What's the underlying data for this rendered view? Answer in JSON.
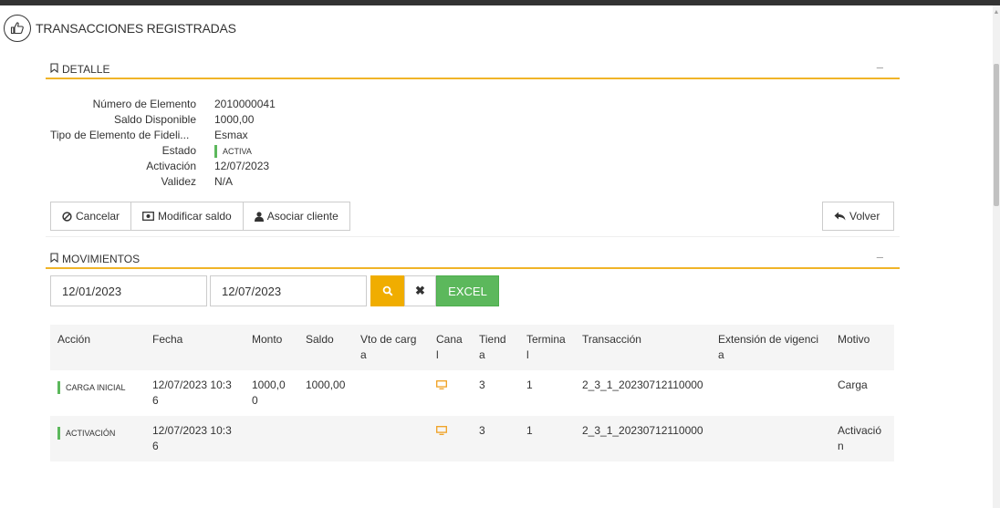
{
  "page": {
    "title": "TRANSACCIONES REGISTRADAS"
  },
  "detalle": {
    "section_label": "DETALLE",
    "collapse": "–",
    "rows": [
      {
        "label": "Número de Elemento",
        "value": "2010000041"
      },
      {
        "label": "Saldo Disponible",
        "value": "1000,00"
      },
      {
        "label": "Tipo de Elemento de Fideli...",
        "value": "Esmax"
      },
      {
        "label": "Estado",
        "value": "ACTIVA"
      },
      {
        "label": "Activación",
        "value": "12/07/2023"
      },
      {
        "label": "Validez",
        "value": "N/A"
      }
    ],
    "status_color": "#5cb85c"
  },
  "actions": {
    "cancelar": "Cancelar",
    "modificar": "Modificar saldo",
    "asociar": "Asociar cliente",
    "volver": "Volver"
  },
  "movimientos": {
    "section_label": "MOVIMIENTOS",
    "collapse": "–",
    "date_from": "12/01/2023",
    "date_to": "12/07/2023",
    "excel_label": "EXCEL",
    "columns": [
      "Acción",
      "Fecha",
      "Monto",
      "Saldo",
      "Vto de carga",
      "Canal",
      "Tienda",
      "Terminal",
      "Transacción",
      "Extensión de vigencia",
      "Motivo"
    ],
    "rows": [
      {
        "accion": "CARGA INICIAL",
        "fecha": "12/07/2023 10:36",
        "monto": "1000,00",
        "saldo": "1000,00",
        "vto": "",
        "canal_icon": "monitor-icon",
        "tienda": "3",
        "terminal": "1",
        "transaccion": "2_3_1_20230712110000",
        "extension": "",
        "motivo": "Carga"
      },
      {
        "accion": "ACTIVACIÓN",
        "fecha": "12/07/2023 10:36",
        "monto": "",
        "saldo": "",
        "vto": "",
        "canal_icon": "monitor-icon",
        "tienda": "3",
        "terminal": "1",
        "transaccion": "2_3_1_20230712110000",
        "extension": "",
        "motivo": "Activación"
      }
    ]
  },
  "colors": {
    "accent": "#f0b428",
    "search": "#f0ad00",
    "excel": "#5cb85c",
    "canal_icon": "#f0a020"
  }
}
